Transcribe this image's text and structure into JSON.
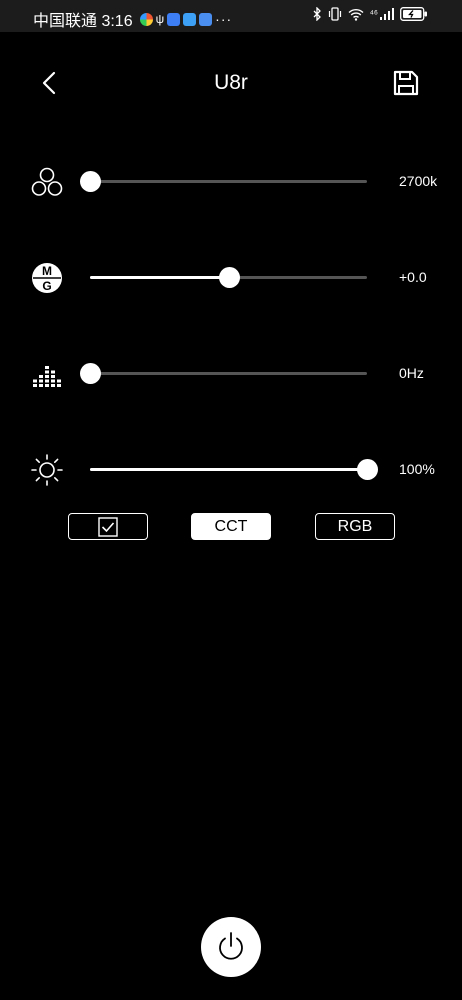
{
  "status_bar": {
    "carrier_time": "中国联通 3:16",
    "overflow": "···",
    "signal_label": "⁴⁶"
  },
  "header": {
    "title": "U8r"
  },
  "sliders": [
    {
      "id": "cct",
      "icon": "three-circles-icon",
      "value_text": "2700k",
      "level": 0.0
    },
    {
      "id": "tint",
      "icon": "mg-tint-icon",
      "value_text": "+0.0",
      "level": 0.5
    },
    {
      "id": "effect",
      "icon": "frequency-bars-icon",
      "value_text": "0Hz",
      "level": 0.0
    },
    {
      "id": "brightness",
      "icon": "sun-icon",
      "value_text": "100%",
      "level": 1.0
    }
  ],
  "modes": {
    "cct_label": "CCT",
    "rgb_label": "RGB",
    "active": "CCT"
  },
  "colors": {
    "background": "#000000",
    "track": "#555555",
    "thumb": "#ffffff"
  }
}
